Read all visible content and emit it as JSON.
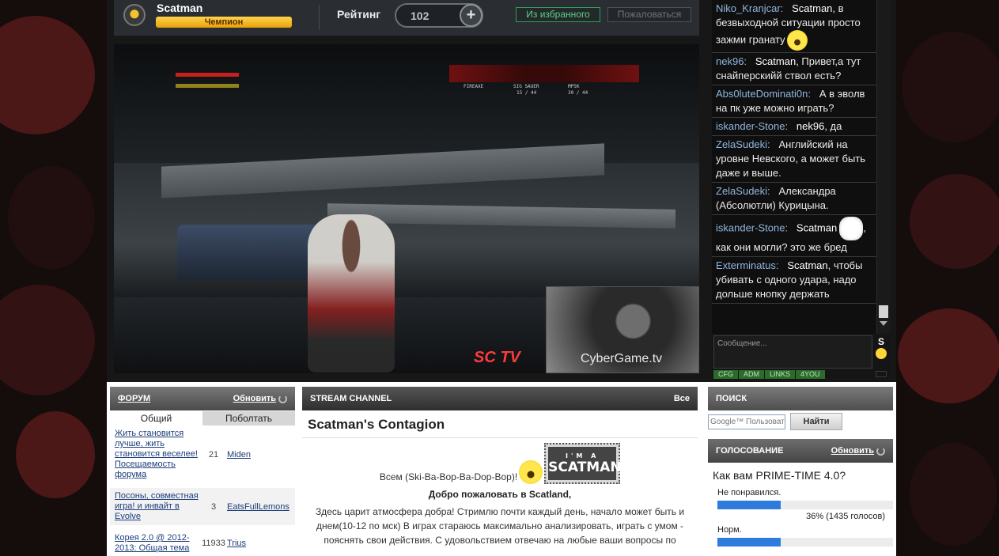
{
  "profile": {
    "username": "Scatman",
    "rank": "Чемпион",
    "rating_label": "Рейтинг",
    "rating_value": "102",
    "plus_label": "+",
    "fav_button": "Из избранного",
    "complain_button": "Пожаловаться"
  },
  "video": {
    "hud_weapon_1": "FIREAXE",
    "hud_weapon_2": "SIG SAUER",
    "hud_ammo_2": "15 / 44",
    "hud_weapon_3": "MP5K",
    "hud_ammo_3": "30 / 44",
    "logo_left": "SC TV",
    "logo_right": "CyberGame.tv"
  },
  "chat": {
    "messages": [
      {
        "nick": "Niko_Kranjcar:",
        "mention": "Scatman",
        "text": ", в безвыходной ситуации просто зажми гранату",
        "emote": "smiley"
      },
      {
        "nick": "nek96:",
        "mention": "Scatman",
        "text": ", Привет,а тут снайперскийй ствол есть?",
        "emote": ""
      },
      {
        "nick": "Abs0luteDominati0n:",
        "mention": "",
        "text": "А в эволв на пк уже можно играть?",
        "emote": ""
      },
      {
        "nick": "iskander-Stone:",
        "mention": "nek96",
        "text": ", да",
        "emote": ""
      },
      {
        "nick": "ZelaSudeki:",
        "mention": "",
        "text": "Английский на уровне Невского, а может быть даже и выше.",
        "emote": ""
      },
      {
        "nick": "ZelaSudeki:",
        "mention": "",
        "text": "Александра (Абсолютли) Курицына.",
        "emote": ""
      },
      {
        "nick": "iskander-Stone:",
        "mention": "Scatman",
        "text": ", как они могли? это же бред",
        "emote": "meme"
      },
      {
        "nick": "Exterminatus:",
        "mention": "Scatman",
        "text": ", чтобы убивать с одного удара, надо дольше кнопку держать",
        "emote": ""
      }
    ],
    "input_placeholder": "Сообщение...",
    "send_label": "S",
    "tabs": [
      "CFG",
      "ADM",
      "LINKS",
      "4YOU"
    ]
  },
  "forum": {
    "title": "ФОРУМ",
    "refresh": "Обновить",
    "tabs": [
      "Общий",
      "Поболтать"
    ],
    "rows": [
      {
        "topic": "Жить становится лучше, жить становится веселее! Посещаемость форума",
        "count": "21",
        "author": "Miden"
      },
      {
        "topic": "Посоны, совместная игра! и инвайт в Evolve",
        "count": "3",
        "author": "EatsFullLemons"
      },
      {
        "topic": "Корея 2.0 @ 2012-2013: Общая тема",
        "count": "11933",
        "author": "Trius"
      }
    ]
  },
  "stream": {
    "header": "STREAM CHANNEL",
    "all_link": "Все",
    "title": "Scatman's Contagion",
    "greeting": "Всем (Ski-Ba-Bop-Ba-Dop-Bop)!",
    "logo_small": "I'M A",
    "logo_big": "SCATMAN",
    "welcome": "Добро пожаловать в Scatland,",
    "description": "Здесь царит атмосфера добра! Стримлю почти каждый день, начало может быть и днем(10-12 по мск) В играх стараюсь максимально анализировать, играть с умом - пояснять свои действия. С удовольствием отвечаю на любые ваши вопросы по"
  },
  "search": {
    "title": "ПОИСК",
    "placeholder": "Google™ Пользовате",
    "button": "Найти"
  },
  "poll": {
    "title": "ГОЛОСОВАНИЕ",
    "refresh": "Обновить",
    "question": "Как вам PRIME-TIME 4.0?",
    "options": [
      {
        "label": "Не понравился.",
        "percent": 36,
        "result": "36% (1435 голосов)"
      },
      {
        "label": "Норм.",
        "percent": 36,
        "result": ""
      }
    ]
  },
  "colors": {
    "accent_green": "#2e9c55",
    "rank_gold": "#e8a10c",
    "chat_nick": "#8fb6dc",
    "poll_bar": "#2d7bdc",
    "link_blue": "#1d3d7a"
  }
}
